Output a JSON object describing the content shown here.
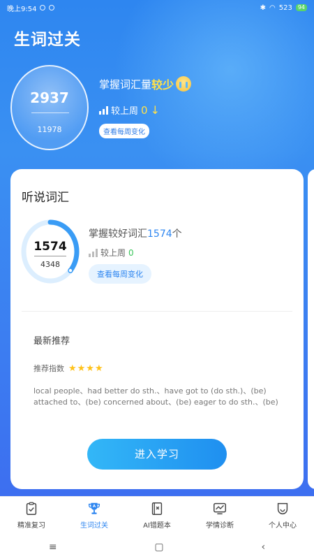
{
  "status": {
    "time": "晚上9:54",
    "speed": "523",
    "battery": "94"
  },
  "page_title": "生词过关",
  "summary": {
    "mastered": "2937",
    "total": "11978",
    "headline_prefix": "掌握词汇量",
    "headline_level": "较少",
    "compare_label": "较上周",
    "compare_value": "0",
    "week_button": "查看每周变化"
  },
  "card": {
    "title": "听说词汇",
    "mastered": "1574",
    "total": "4348",
    "master_prefix": "掌握较好词汇",
    "master_value": "1574",
    "master_suffix": "个",
    "compare_label": "较上周",
    "compare_value": "0",
    "week_button": "查看每周变化",
    "recommend_title": "最新推荐",
    "recommend_index_label": "推荐指数",
    "recommend_stars": 4,
    "phrases": "local people、had better do sth.、have got to (do sth.)、(be) attached to、(be) concerned about、(be) eager to do sth.、(be) de...",
    "study_button": "进入学习"
  },
  "tabs": [
    {
      "label": "精准复习",
      "icon": "clipboard-check-icon",
      "active": false
    },
    {
      "label": "生词过关",
      "icon": "trophy-icon",
      "active": true
    },
    {
      "label": "AI错题本",
      "icon": "notebook-icon",
      "active": false
    },
    {
      "label": "学情诊断",
      "icon": "chart-monitor-icon",
      "active": false
    },
    {
      "label": "个人中心",
      "icon": "smile-profile-icon",
      "active": false
    }
  ],
  "colors": {
    "primary": "#2e86f0",
    "accent_yellow": "#ffe14a",
    "green": "#3ac55b",
    "star": "#ffc21a"
  }
}
